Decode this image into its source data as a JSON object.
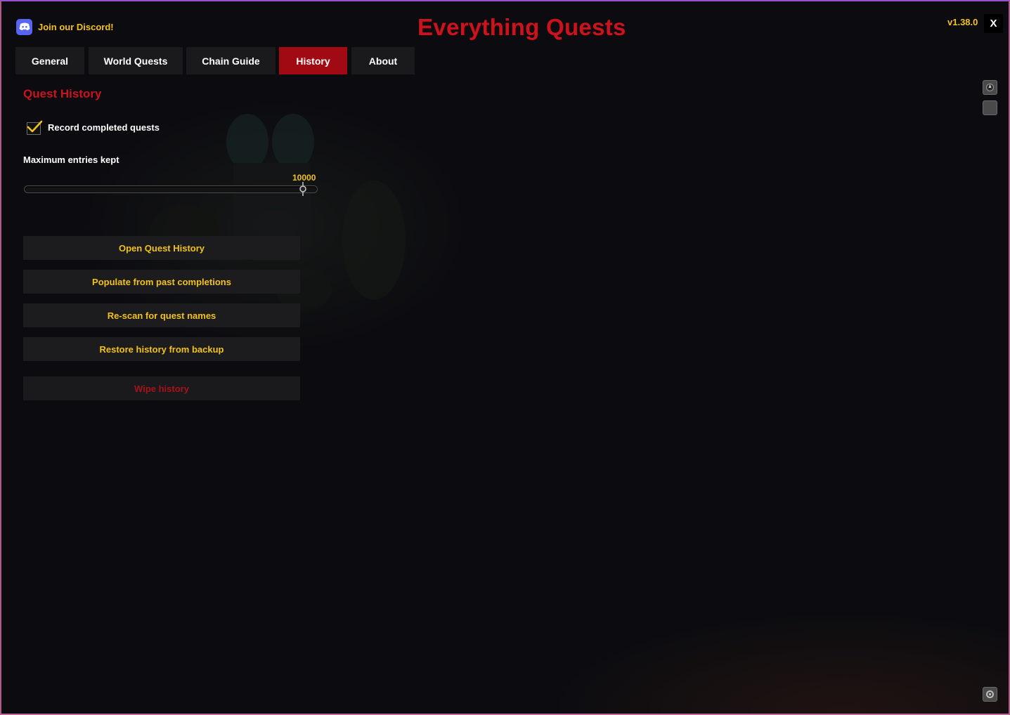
{
  "header": {
    "discord_label": "Join our Discord!",
    "title": "Everything Quests",
    "version": "v1.38.0",
    "close_label": "X"
  },
  "tabs": [
    {
      "label": "General",
      "active": false
    },
    {
      "label": "World Quests",
      "active": false
    },
    {
      "label": "Chain Guide",
      "active": false
    },
    {
      "label": "History",
      "active": true
    },
    {
      "label": "About",
      "active": false
    }
  ],
  "history": {
    "section_title": "Quest History",
    "record_checkbox": {
      "label": "Record completed quests",
      "checked": true
    },
    "max_entries": {
      "label": "Maximum entries kept",
      "value": "10000",
      "fraction": 0.95
    },
    "buttons": {
      "open": "Open Quest History",
      "populate": "Populate from past completions",
      "rescan": "Re-scan for quest names",
      "restore": "Restore history from backup",
      "wipe": "Wipe history"
    }
  },
  "side_icons": [
    "minimap-icon",
    "square-icon",
    "settings-icon"
  ],
  "colors": {
    "accent_red": "#c8141e",
    "active_tab": "#a10a12",
    "gold_text": "#f2c21a",
    "discord": "#5865f2"
  }
}
